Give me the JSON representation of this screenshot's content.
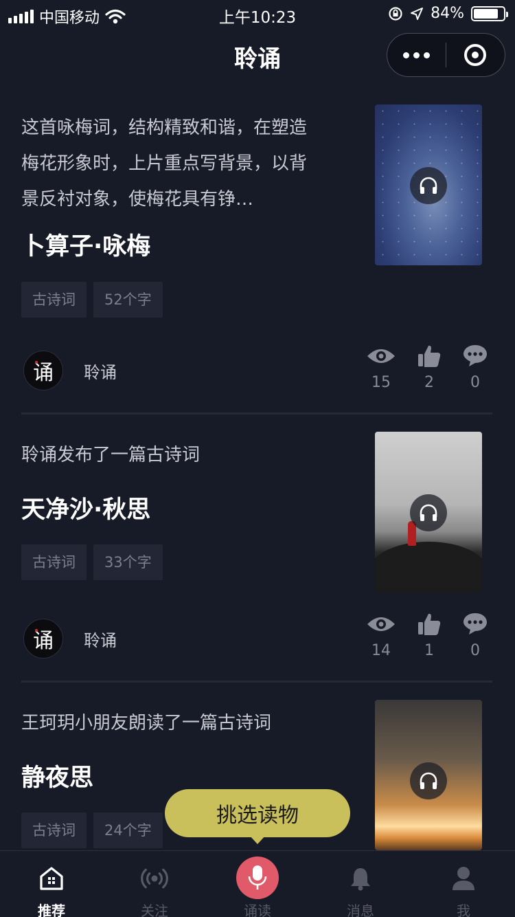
{
  "status_bar": {
    "carrier": "中国移动",
    "time": "上午10:23",
    "battery": "84%",
    "battery_level": 0.84
  },
  "nav": {
    "title": "聆诵"
  },
  "feed": [
    {
      "description": "这首咏梅词，结构精致和谐，在塑造梅花形象时，上片重点写背景，以背景反衬对象，使梅花具有铮…",
      "title": "卜算子·咏梅",
      "tags": [
        "古诗词",
        "52个字"
      ],
      "author": "聆诵",
      "avatar_char": "诵",
      "views": "15",
      "likes": "2",
      "comments": "0"
    },
    {
      "description": "聆诵发布了一篇古诗词",
      "title": "天净沙·秋思",
      "tags": [
        "古诗词",
        "33个字"
      ],
      "author": "聆诵",
      "avatar_char": "诵",
      "views": "14",
      "likes": "1",
      "comments": "0"
    },
    {
      "description": "王珂玥小朋友朗读了一篇古诗词",
      "title": "静夜思",
      "tags": [
        "古诗词",
        "24个字"
      ]
    }
  ],
  "pick_button": "挑选读物",
  "tabs": [
    {
      "label": "推荐",
      "icon": "home-icon",
      "active": true
    },
    {
      "label": "关注",
      "icon": "broadcast-icon",
      "active": false
    },
    {
      "label": "诵读",
      "icon": "microphone-icon",
      "active": false
    },
    {
      "label": "消息",
      "icon": "bell-icon",
      "active": false
    },
    {
      "label": "我",
      "icon": "person-icon",
      "active": false
    }
  ],
  "colors": {
    "background": "#171a27",
    "accent_yellow": "#c9bf5b",
    "mic_red": "#e05a6a"
  }
}
